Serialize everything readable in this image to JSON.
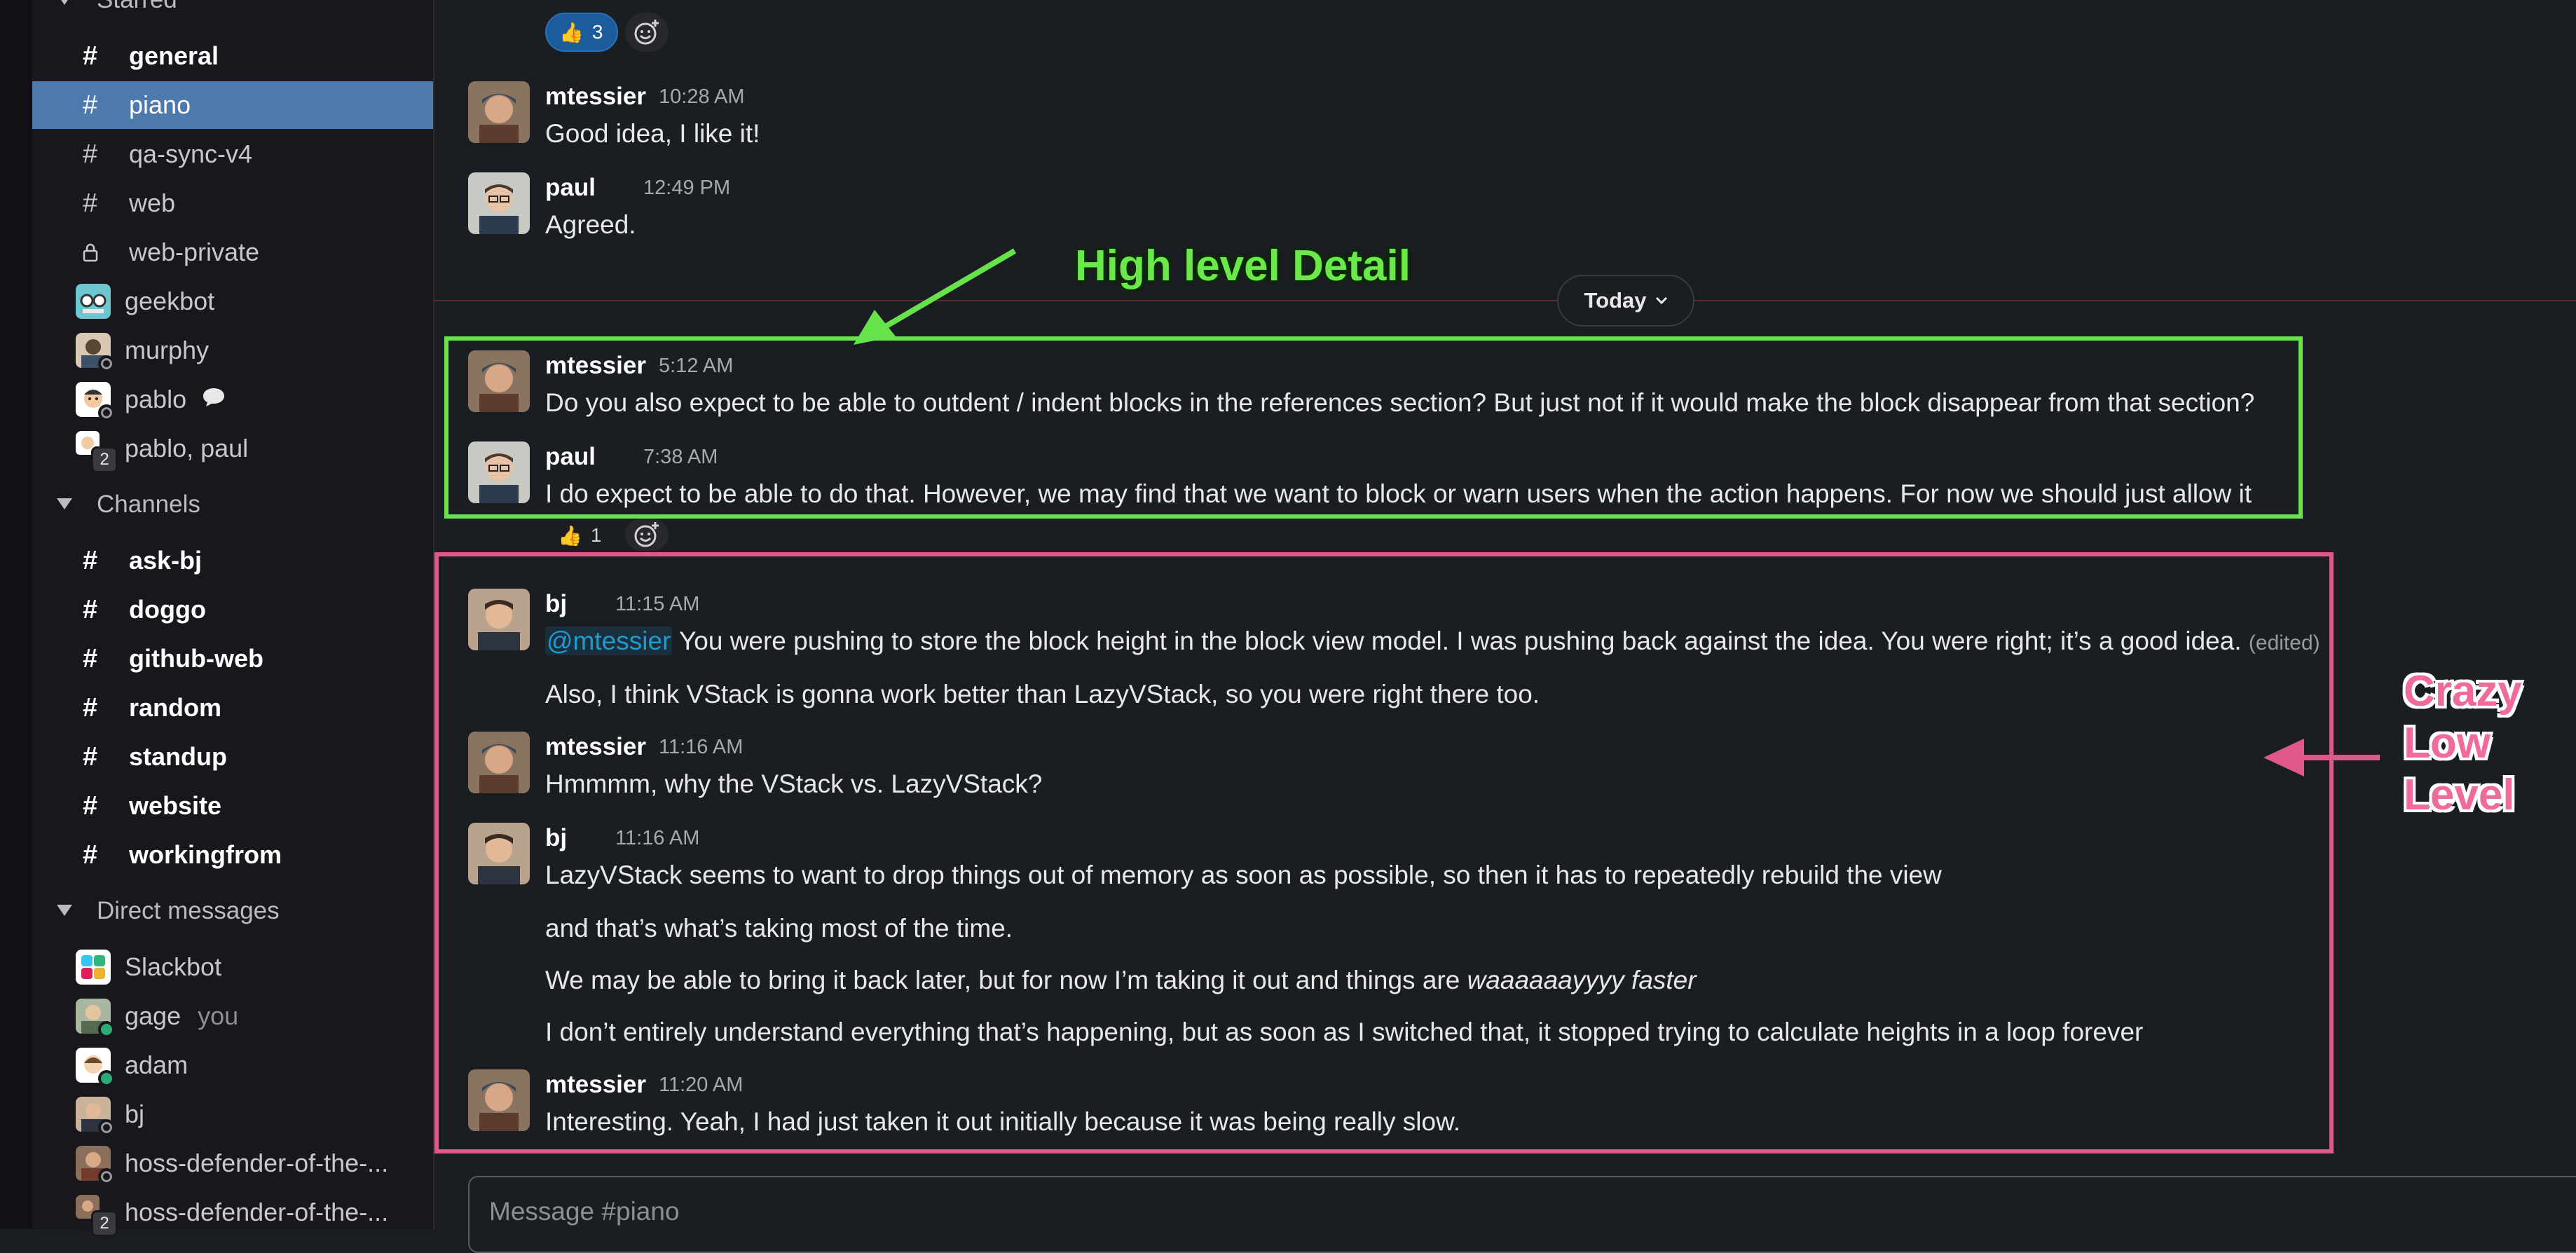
{
  "sidebar": {
    "starred_header": "Starred",
    "starred": [
      {
        "type": "channel",
        "label": "general",
        "bold": true
      },
      {
        "type": "channel",
        "label": "piano",
        "selected": true
      },
      {
        "type": "channel",
        "label": "qa-sync-v4"
      },
      {
        "type": "channel",
        "label": "web"
      },
      {
        "type": "private",
        "label": "web-private"
      },
      {
        "type": "dm",
        "label": "geekbot"
      },
      {
        "type": "dm",
        "label": "murphy"
      },
      {
        "type": "dm",
        "label": "pablo"
      },
      {
        "type": "group",
        "label": "pablo, paul",
        "count": "2"
      }
    ],
    "channels_header": "Channels",
    "channels": [
      {
        "label": "ask-bj"
      },
      {
        "label": "doggo"
      },
      {
        "label": "github-web"
      },
      {
        "label": "random"
      },
      {
        "label": "standup"
      },
      {
        "label": "website"
      },
      {
        "label": "workingfrom"
      }
    ],
    "dms_header": "Direct messages",
    "dms": [
      {
        "label": "Slackbot"
      },
      {
        "label": "gage",
        "suffix": "you"
      },
      {
        "label": "adam"
      },
      {
        "label": "bj"
      },
      {
        "label": "hoss-defender-of-the-..."
      },
      {
        "label": "hoss-defender-of-the-...",
        "count": "2"
      }
    ]
  },
  "main": {
    "top_reaction": {
      "emoji": "👍",
      "count": "3"
    },
    "early_messages": [
      {
        "author": "mtessier",
        "time": "10:28 AM",
        "text": "Good idea, I like it!"
      },
      {
        "author": "paul",
        "time": "12:49 PM",
        "text": "Agreed."
      }
    ],
    "divider_label": "Today",
    "today_messages": [
      {
        "author": "mtessier",
        "time": "5:12 AM",
        "text": "Do you also expect to be able to outdent / indent blocks in the references section? But just not if it would make the block disappear from that section?"
      },
      {
        "author": "paul",
        "time": "7:38 AM",
        "text": "I do expect to be able to do that. However, we may find that we want to block or warn users when the action happens. For now we should just allow it"
      }
    ],
    "mid_reaction": {
      "emoji": "👍",
      "count": "1"
    },
    "bj_1": {
      "author": "bj",
      "time": "11:15 AM",
      "mention": "@mtessier",
      "line1": " You were pushing to store the block height in the block view model. I was pushing back against the idea. You were right; it’s a good idea. ",
      "edited": "(edited)",
      "line2": "Also, I think VStack is gonna work better than LazyVStack, so you were right there too."
    },
    "mt_1": {
      "author": "mtessier",
      "time": "11:16 AM",
      "text": "Hmmmm, why the VStack vs. LazyVStack?"
    },
    "bj_2": {
      "author": "bj",
      "time": "11:16 AM",
      "line1": "LazyVStack seems to want to drop things out of memory as soon as possible, so then it has to repeatedly rebuild the view",
      "line2": "and that’s what’s taking most of the time.",
      "line3_pre": "We may be able to bring it back later, but for now I’m taking it out and things are ",
      "line3_em": "waaaaaayyyy faster",
      "line4": "I don’t entirely understand everything that’s happening, but as soon as I switched that, it stopped trying to calculate heights in a loop forever"
    },
    "mt_2": {
      "author": "mtessier",
      "time": "11:20 AM",
      "text": "Interesting. Yeah, I had just taken it out initially because it was being really slow."
    },
    "composer_placeholder": "Message #piano"
  },
  "annotations": {
    "green_label": "High level Detail",
    "pink_label": [
      "Crazy",
      "Low",
      "Level"
    ],
    "green_color": "#66e34b",
    "pink_color": "#e0578c"
  },
  "colors": {
    "selected": "#4d79ad",
    "mention": "#1d9bd1",
    "online": "#2bac76"
  }
}
